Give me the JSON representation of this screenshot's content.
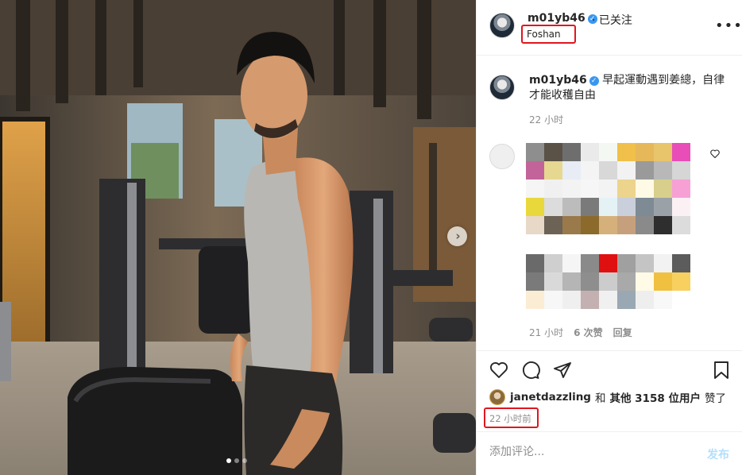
{
  "post": {
    "username": "m01yb46",
    "verified_mark": "✓",
    "follow_status": "· 已关注",
    "location": "Foshan",
    "more_icon": "•••"
  },
  "caption": {
    "username": "m01yb46",
    "text": "早起運動遇到姜總，自律才能收穫自由",
    "time": "22 小时"
  },
  "comment": {
    "time": "21 小时",
    "likes": "6 次赞",
    "reply": "回复"
  },
  "actions": {
    "liked_by_user": "janetdazzling",
    "and": "和",
    "others": "其他 3158 位用户",
    "liked": "赞了",
    "time_ago": "22 小时前"
  },
  "add_comment": {
    "placeholder": "添加评论...",
    "post_label": "发布"
  },
  "carousel": {
    "next_glyph": "›",
    "pages": 3,
    "current": 1
  },
  "colors": {
    "highlight_box": "#e0161f",
    "verified": "#3897f0",
    "post_button_disabled": "#b2dffc"
  }
}
